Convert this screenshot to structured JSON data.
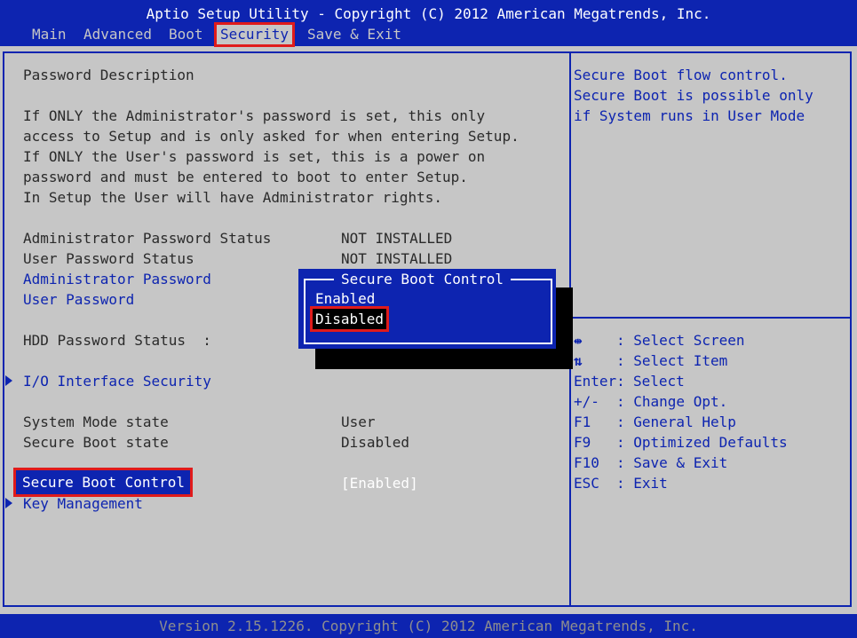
{
  "header": {
    "title": "Aptio Setup Utility - Copyright (C) 2012 American Megatrends, Inc.",
    "tabs": [
      {
        "label": "Main"
      },
      {
        "label": "Advanced"
      },
      {
        "label": "Boot"
      },
      {
        "label": "Security"
      },
      {
        "label": "Save & Exit"
      }
    ],
    "active_tab": "Security"
  },
  "main": {
    "description_title": "Password Description",
    "description_lines": [
      "If ONLY the Administrator's password is set, this only",
      "access to Setup and is only asked for when entering Setup.",
      "If ONLY the User's password is set, this is a power on",
      "password and must be entered to boot to enter Setup.",
      "In Setup the User will have Administrator rights."
    ],
    "admin_status_label": "Administrator Password Status",
    "admin_status_value": "NOT INSTALLED",
    "user_status_label": "User Password Status",
    "user_status_value": "NOT INSTALLED",
    "admin_password_link": "Administrator Password",
    "user_password_link": "User Password",
    "hdd_status_label": "HDD Password Status  :",
    "io_security_link": "I/O Interface Security",
    "system_mode_label": "System Mode state",
    "system_mode_value": "User",
    "secure_boot_state_label": "Secure Boot state",
    "secure_boot_state_value": "Disabled",
    "secure_boot_control_label": "Secure Boot Control",
    "secure_boot_control_value": "[Enabled]",
    "key_management_link": "Key Management"
  },
  "popup": {
    "title": "Secure Boot Control",
    "options": [
      "Enabled",
      "Disabled"
    ],
    "selected": "Disabled"
  },
  "help": {
    "lines": [
      "Secure Boot flow control.",
      "Secure Boot is possible only",
      "if System runs in User Mode"
    ],
    "keys": [
      {
        "key": "",
        "icon": "left-right-arrows-icon",
        "desc": ": Select Screen"
      },
      {
        "key": "",
        "icon": "up-down-arrows-icon",
        "desc": ": Select Item"
      },
      {
        "key": "Enter:",
        "desc": "Select"
      },
      {
        "key": "+/-",
        "desc": ": Change Opt."
      },
      {
        "key": "F1",
        "desc": ": General Help"
      },
      {
        "key": "F9",
        "desc": ": Optimized Defaults"
      },
      {
        "key": "F10",
        "desc": ": Save & Exit"
      },
      {
        "key": "ESC",
        "desc": ": Exit"
      }
    ]
  },
  "footer": {
    "text": "Version 2.15.1226. Copyright (C) 2012 American Megatrends, Inc."
  },
  "colors": {
    "bios_blue": "#0d24b0",
    "panel_gray": "#c6c6c6",
    "highlight_red": "#e01b1b"
  }
}
